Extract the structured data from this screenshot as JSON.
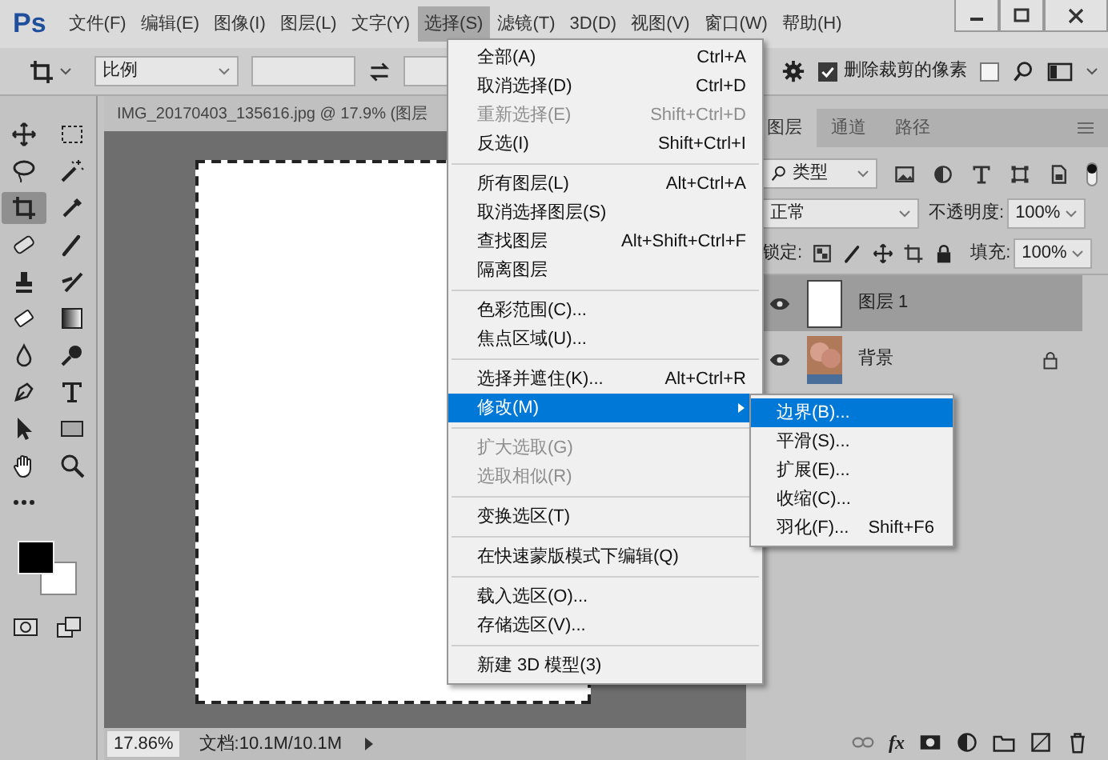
{
  "app": {
    "logo": "Ps"
  },
  "menubar": [
    {
      "label": "文件(F)",
      "selected": false
    },
    {
      "label": "编辑(E)",
      "selected": false
    },
    {
      "label": "图像(I)",
      "selected": false
    },
    {
      "label": "图层(L)",
      "selected": false
    },
    {
      "label": "文字(Y)",
      "selected": false
    },
    {
      "label": "选择(S)",
      "selected": true
    },
    {
      "label": "滤镜(T)",
      "selected": false
    },
    {
      "label": "3D(D)",
      "selected": false
    },
    {
      "label": "视图(V)",
      "selected": false
    },
    {
      "label": "窗口(W)",
      "selected": false
    },
    {
      "label": "帮助(H)",
      "selected": false
    }
  ],
  "options_bar": {
    "ratio": "比例",
    "delete_cropped": {
      "label": "删除裁剪的像素",
      "checked": true
    },
    "content_aware": {
      "checked": false
    }
  },
  "tools": [
    {
      "kind": "move",
      "selected": false
    },
    {
      "kind": "marquee",
      "selected": false
    },
    {
      "kind": "lasso",
      "selected": false
    },
    {
      "kind": "wand",
      "selected": false
    },
    {
      "kind": "crop",
      "selected": true
    },
    {
      "kind": "eyedropper",
      "selected": false
    },
    {
      "kind": "bandage",
      "selected": false
    },
    {
      "kind": "brush",
      "selected": false
    },
    {
      "kind": "stamp",
      "selected": false
    },
    {
      "kind": "history",
      "selected": false
    },
    {
      "kind": "eraser",
      "selected": false
    },
    {
      "kind": "gradient",
      "selected": false
    },
    {
      "kind": "blur",
      "selected": false
    },
    {
      "kind": "dodge",
      "selected": false
    },
    {
      "kind": "pen",
      "selected": false
    },
    {
      "kind": "type",
      "selected": false
    },
    {
      "kind": "pathselect",
      "selected": false
    },
    {
      "kind": "shape",
      "selected": false
    },
    {
      "kind": "hand",
      "selected": false
    },
    {
      "kind": "zoom",
      "selected": false
    },
    {
      "kind": "more",
      "selected": false
    }
  ],
  "document": {
    "tab_title": "IMG_20170403_135616.jpg @ 17.9% (图层"
  },
  "status_bar": {
    "zoom": "17.86%",
    "doc_size": "文档:10.1M/10.1M"
  },
  "layers_panel": {
    "tabs": [
      {
        "label": "图层",
        "selected": true
      },
      {
        "label": "通道",
        "selected": false
      },
      {
        "label": "路径",
        "selected": false
      }
    ],
    "filter": "类型",
    "filter_on": true,
    "blend_mode": "正常",
    "opacity_label": "不透明度:",
    "opacity": "100%",
    "lock_label": "锁定:",
    "fill_label": "填充:",
    "fill": "100%",
    "layers": [
      {
        "name": "图层 1",
        "kind": "blank",
        "visible": true,
        "selected": true,
        "locked": false
      },
      {
        "name": "背景",
        "kind": "photo",
        "visible": true,
        "selected": false,
        "locked": true
      }
    ],
    "footer_fx": "fx"
  },
  "select_menu": {
    "groups": [
      [
        {
          "label": "全部(A)",
          "shortcut": "Ctrl+A",
          "disabled": false,
          "selected": false,
          "submenu": false
        },
        {
          "label": "取消选择(D)",
          "shortcut": "Ctrl+D",
          "disabled": false,
          "selected": false,
          "submenu": false
        },
        {
          "label": "重新选择(E)",
          "shortcut": "Shift+Ctrl+D",
          "disabled": true,
          "selected": false,
          "submenu": false
        },
        {
          "label": "反选(I)",
          "shortcut": "Shift+Ctrl+I",
          "disabled": false,
          "selected": false,
          "submenu": false
        }
      ],
      [
        {
          "label": "所有图层(L)",
          "shortcut": "Alt+Ctrl+A",
          "disabled": false,
          "selected": false,
          "submenu": false
        },
        {
          "label": "取消选择图层(S)",
          "disabled": false,
          "selected": false,
          "submenu": false
        },
        {
          "label": "查找图层",
          "shortcut": "Alt+Shift+Ctrl+F",
          "disabled": false,
          "selected": false,
          "submenu": false
        },
        {
          "label": "隔离图层",
          "disabled": false,
          "selected": false,
          "submenu": false
        }
      ],
      [
        {
          "label": "色彩范围(C)...",
          "disabled": false,
          "selected": false,
          "submenu": false
        },
        {
          "label": "焦点区域(U)...",
          "disabled": false,
          "selected": false,
          "submenu": false
        }
      ],
      [
        {
          "label": "选择并遮住(K)...",
          "shortcut": "Alt+Ctrl+R",
          "disabled": false,
          "selected": false,
          "submenu": false
        },
        {
          "label": "修改(M)",
          "disabled": false,
          "selected": true,
          "submenu": true
        }
      ],
      [
        {
          "label": "扩大选取(G)",
          "disabled": true,
          "selected": false,
          "submenu": false
        },
        {
          "label": "选取相似(R)",
          "disabled": true,
          "selected": false,
          "submenu": false
        }
      ],
      [
        {
          "label": "变换选区(T)",
          "disabled": false,
          "selected": false,
          "submenu": false
        }
      ],
      [
        {
          "label": "在快速蒙版模式下编辑(Q)",
          "disabled": false,
          "selected": false,
          "submenu": false
        }
      ],
      [
        {
          "label": "载入选区(O)...",
          "disabled": false,
          "selected": false,
          "submenu": false
        },
        {
          "label": "存储选区(V)...",
          "disabled": false,
          "selected": false,
          "submenu": false
        }
      ],
      [
        {
          "label": "新建 3D 模型(3)",
          "disabled": false,
          "selected": false,
          "submenu": false
        }
      ]
    ]
  },
  "modify_submenu": [
    {
      "label": "边界(B)...",
      "selected": true
    },
    {
      "label": "平滑(S)...",
      "selected": false
    },
    {
      "label": "扩展(E)...",
      "selected": false
    },
    {
      "label": "收缩(C)...",
      "selected": false
    },
    {
      "label": "羽化(F)...",
      "shortcut": "Shift+F6",
      "selected": false
    }
  ]
}
